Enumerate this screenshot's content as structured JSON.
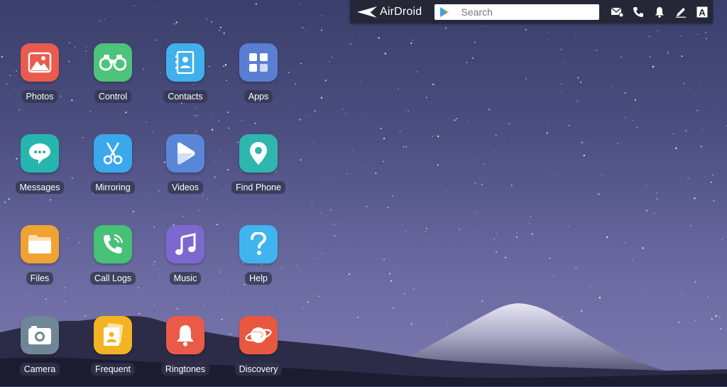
{
  "topbar": {
    "logo_text": "AirDroid",
    "search": {
      "placeholder": "Search",
      "value": ""
    },
    "tools": [
      {
        "name": "messages-icon"
      },
      {
        "name": "phone-icon"
      },
      {
        "name": "notification-icon"
      },
      {
        "name": "edit-icon"
      },
      {
        "name": "font-a-icon",
        "glyph": "A"
      }
    ]
  },
  "apps": [
    {
      "label": "Photos",
      "icon": "photos-icon",
      "color": "#e95b4c"
    },
    {
      "label": "Control",
      "icon": "binoculars-icon",
      "color": "#4ec37a"
    },
    {
      "label": "Contacts",
      "icon": "contacts-icon",
      "color": "#3fb0ec"
    },
    {
      "label": "Apps",
      "icon": "apps-grid-icon",
      "color": "#5a7fd2"
    },
    {
      "label": "Messages",
      "icon": "chat-icon",
      "color": "#27b5b0"
    },
    {
      "label": "Mirroring",
      "icon": "scissors-icon",
      "color": "#3aa8eb"
    },
    {
      "label": "Videos",
      "icon": "play-icon",
      "color": "#5a86d8"
    },
    {
      "label": "Find Phone",
      "icon": "location-pin-icon",
      "color": "#2fb6ad"
    },
    {
      "label": "Files",
      "icon": "folder-icon",
      "color": "#f0a233"
    },
    {
      "label": "Call Logs",
      "icon": "call-icon",
      "color": "#46c175"
    },
    {
      "label": "Music",
      "icon": "music-note-icon",
      "color": "#7d68cf"
    },
    {
      "label": "Help",
      "icon": "question-icon",
      "color": "#3fb4ef"
    },
    {
      "label": "Camera",
      "icon": "camera-icon",
      "color": "#6e8696"
    },
    {
      "label": "Frequent",
      "icon": "frequent-icon",
      "color": "#f4b324"
    },
    {
      "label": "Ringtones",
      "icon": "bell-icon",
      "color": "#e95b48"
    },
    {
      "label": "Discovery",
      "icon": "planet-icon",
      "color": "#e8583f"
    }
  ]
}
